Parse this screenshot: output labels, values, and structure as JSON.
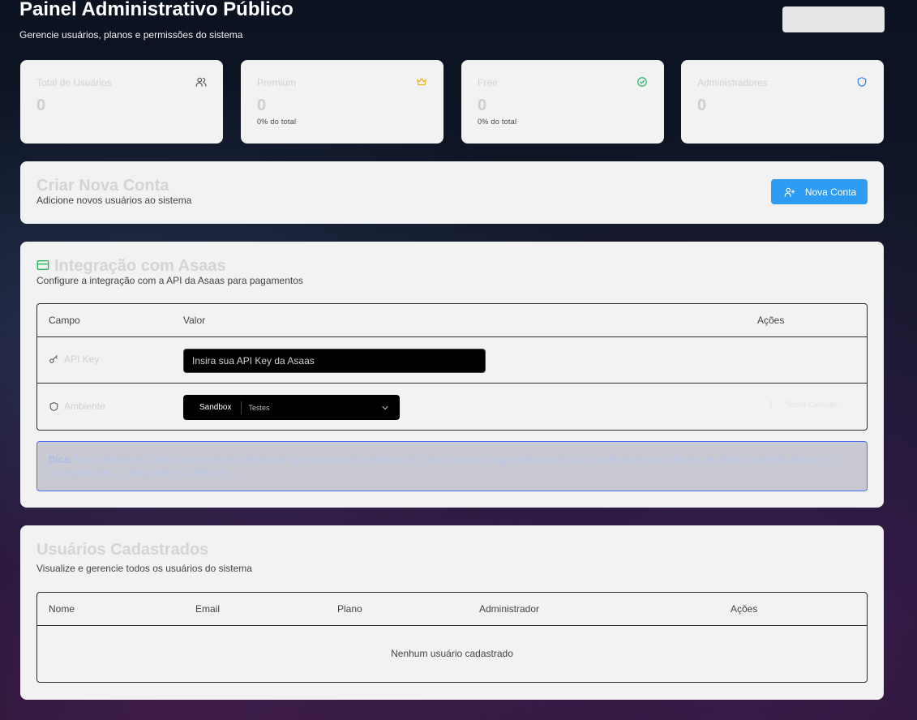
{
  "header": {
    "title": "Painel Administrativo Público",
    "subtitle": "Gerencie usuários, planos e permissões do sistema"
  },
  "stats": [
    {
      "label": "Total de Usuários",
      "value": "0",
      "sub": "",
      "icon": "users-icon"
    },
    {
      "label": "Premium",
      "value": "0",
      "sub": "0% do total",
      "icon": "crown-icon"
    },
    {
      "label": "Free",
      "value": "0",
      "sub": "0% do total",
      "icon": "check-circle-icon"
    },
    {
      "label": "Administradores",
      "value": "0",
      "sub": "",
      "icon": "shield-icon"
    }
  ],
  "create_account": {
    "title": "Criar Nova Conta",
    "desc": "Adicione novos usuários ao sistema",
    "button": "Nova Conta"
  },
  "asaas": {
    "title": "Integração com Asaas",
    "desc": "Configure a integração com a API da Asaas para pagamentos",
    "columns": [
      "Campo",
      "Valor",
      "Ações"
    ],
    "api_key_label": "API Key",
    "api_key_placeholder": "Insira sua API Key da Asaas",
    "env_label": "Ambiente",
    "env_value": "Sandbox",
    "env_hint": "Testes",
    "test_button": "Testar Conexão",
    "tip_bold": "Dica:",
    "tip_text": "Use o ambiente Sandbox para testes e Produção apenas quando estiver pronto para processar pagamentos reais. Você pode obter suas chaves de API no painel da Asaas em: Configurações → Integrações → API Key"
  },
  "users": {
    "title": "Usuários Cadastrados",
    "desc": "Visualize e gerencie todos os usuários do sistema",
    "columns": [
      "Nome",
      "Email",
      "Plano",
      "Administrador",
      "Ações"
    ],
    "empty": "Nenhum usuário cadastrado"
  },
  "footer": {
    "text": ""
  },
  "colors": {
    "primary": "#2f9cf4",
    "premium": "#e7b31a",
    "free": "#27b45a",
    "admin": "#2f7cf4",
    "asaas": "#27b45a",
    "tip_border": "#4d6cf2"
  }
}
